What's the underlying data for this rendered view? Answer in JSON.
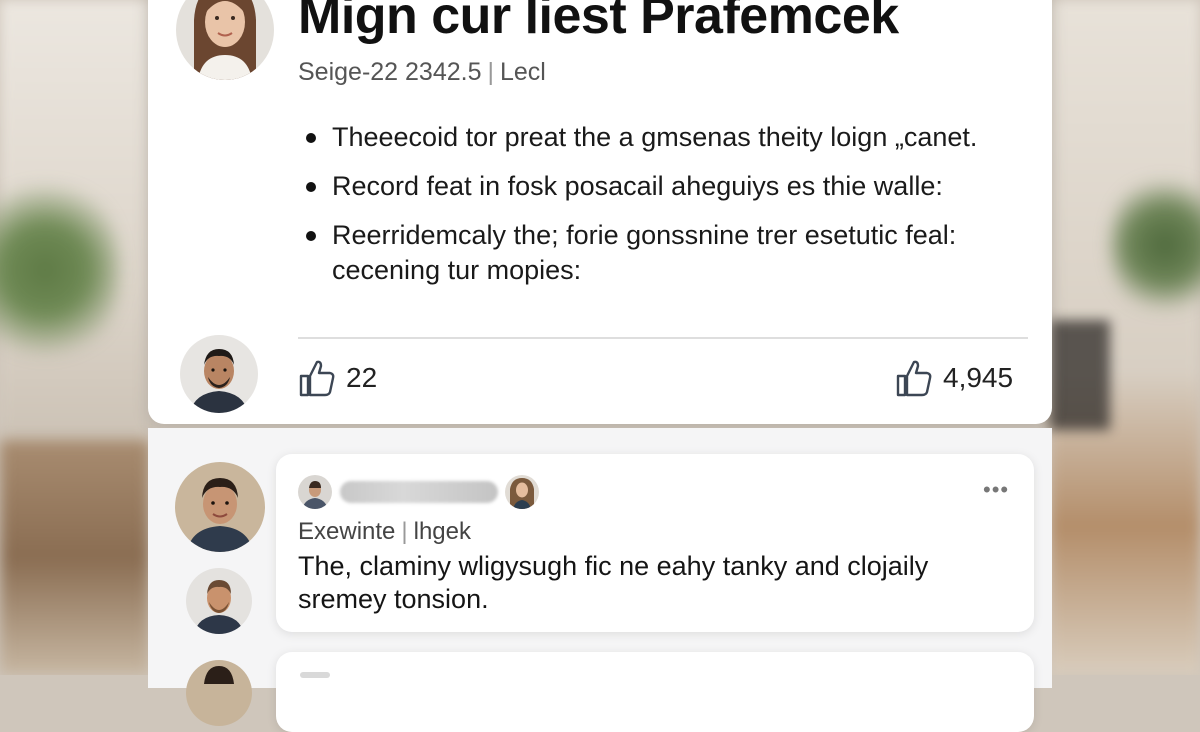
{
  "post": {
    "title": "Mign cur liest Prafemcek",
    "meta_left": "Seige-22 2342.5",
    "meta_separator": "|",
    "meta_right": "Lecl",
    "bullets": [
      "Theeecoid tor preat the a gmsenas theity loign „canet.",
      "Record feat in fosk posacail aheguiys es thie walle:",
      "Reerridemcaly the; forie gonssnine trer esetutic feal: cecening tur mopies:"
    ],
    "likes_left": "22",
    "likes_right": "4,945"
  },
  "comment": {
    "meta_left": "Exewinte",
    "meta_separator": "|",
    "meta_right": "lhgek",
    "text": "The, claminy wligysugh fic ne eahy tanky and clojaily sremey tonsion.",
    "more_icon": "•••"
  },
  "colors": {
    "card_background": "#ffffff",
    "page_background": "#cfc6bb",
    "text_primary": "#111111",
    "text_secondary": "#555555"
  },
  "icons": [
    "thumbs-up-icon",
    "more-horizontal-icon"
  ]
}
